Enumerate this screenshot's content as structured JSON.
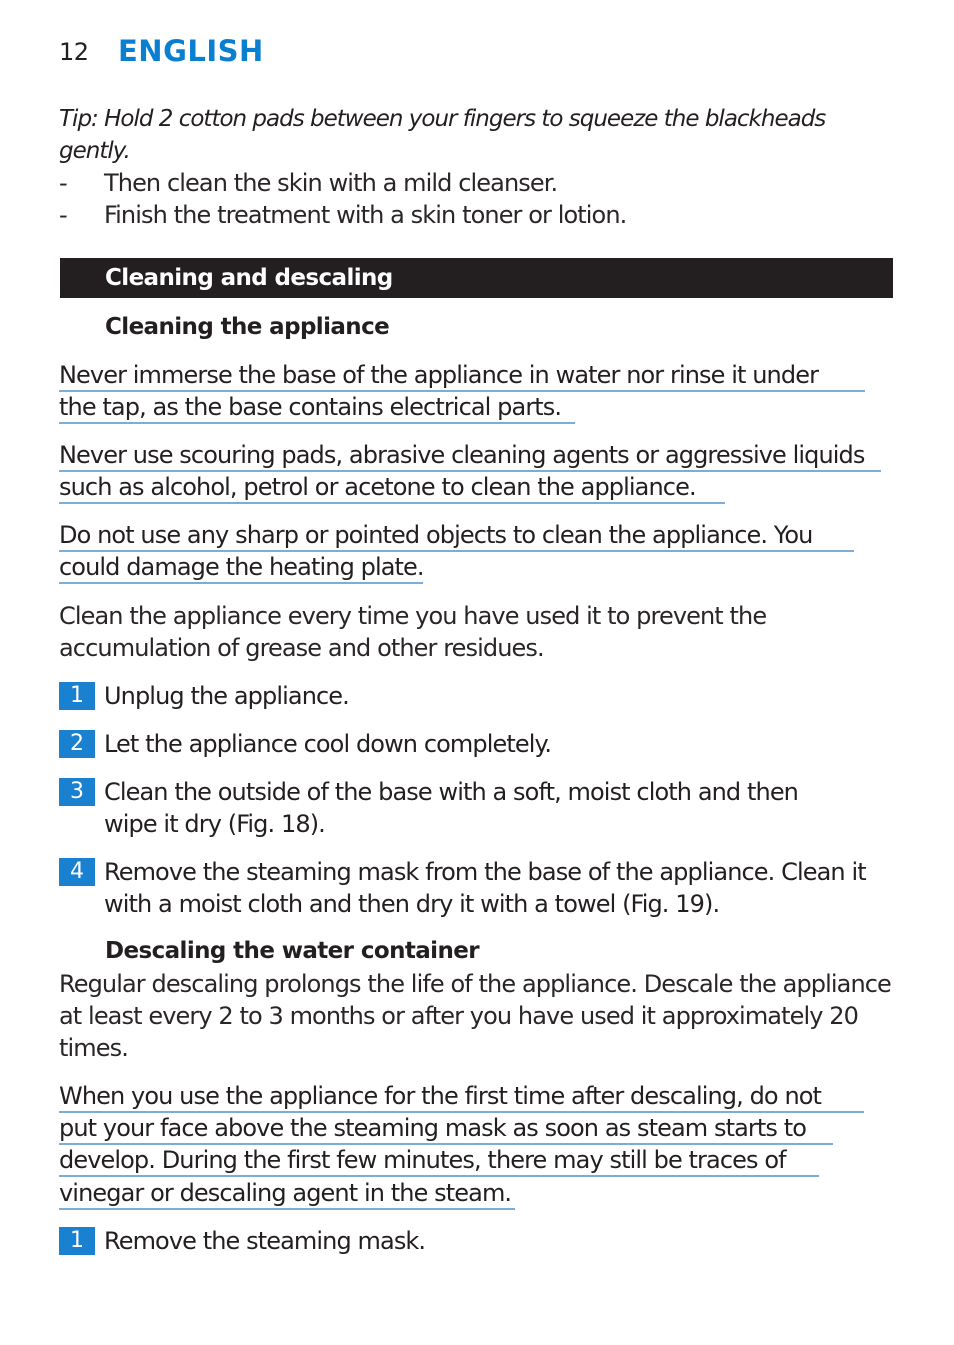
{
  "header": {
    "page_number": "12",
    "language": "ENGLISH"
  },
  "intro": {
    "tip_line1": "Tip: Hold 2 cotton pads between your fingers to squeeze the blackheads",
    "tip_line2": "gently.",
    "bullets": [
      {
        "dash": "-",
        "text": "Then clean the skin with a mild cleanser."
      },
      {
        "dash": "-",
        "text": "Finish the treatment with a skin toner or lotion."
      }
    ]
  },
  "section": {
    "title": "Cleaning and descaling"
  },
  "cleaning": {
    "heading": "Cleaning the appliance",
    "warnings": [
      [
        "Never immerse the base of the appliance in water nor rinse it under",
        "the tap, as the base contains electrical parts."
      ],
      [
        "Never use scouring pads, abrasive cleaning agents or aggressive liquids",
        "such as alcohol, petrol or acetone to clean the appliance."
      ],
      [
        "Do not use any sharp or pointed objects to clean the appliance. You",
        "could damage the heating plate."
      ]
    ],
    "intro_lines": [
      "Clean the appliance every time you have used it to prevent the",
      "accumulation of grease and other residues."
    ],
    "steps": [
      {
        "num": "1",
        "lines": [
          "Unplug the appliance."
        ]
      },
      {
        "num": "2",
        "lines": [
          "Let the appliance cool down completely."
        ]
      },
      {
        "num": "3",
        "lines": [
          "Clean the outside of the base with a soft, moist cloth and then",
          "wipe it dry (Fig. 18)."
        ]
      },
      {
        "num": "4",
        "lines": [
          "Remove the steaming mask from the base of the appliance. Clean it",
          "with a moist cloth and then dry it with a towel (Fig. 19)."
        ]
      }
    ]
  },
  "descaling": {
    "heading": "Descaling the water container",
    "intro_lines": [
      "Regular descaling prolongs the life of the appliance. Descale the appliance",
      "at least every 2 to 3 months or after you have used it approximately 20",
      "times."
    ],
    "warning_lines": [
      "When you use the appliance for the first time after descaling, do not",
      "put your face above the steaming mask as soon as steam starts to",
      "develop. During the first few minutes, there may still be traces of",
      "vinegar or descaling agent in the steam."
    ],
    "steps": [
      {
        "num": "1",
        "lines": [
          "Remove the steaming mask."
        ]
      }
    ]
  },
  "colors": {
    "accent_blue": "#0a7fd0",
    "step_badge": "#1a80d0",
    "warning_underline": "#79aedb",
    "section_bar": "#231f20"
  }
}
